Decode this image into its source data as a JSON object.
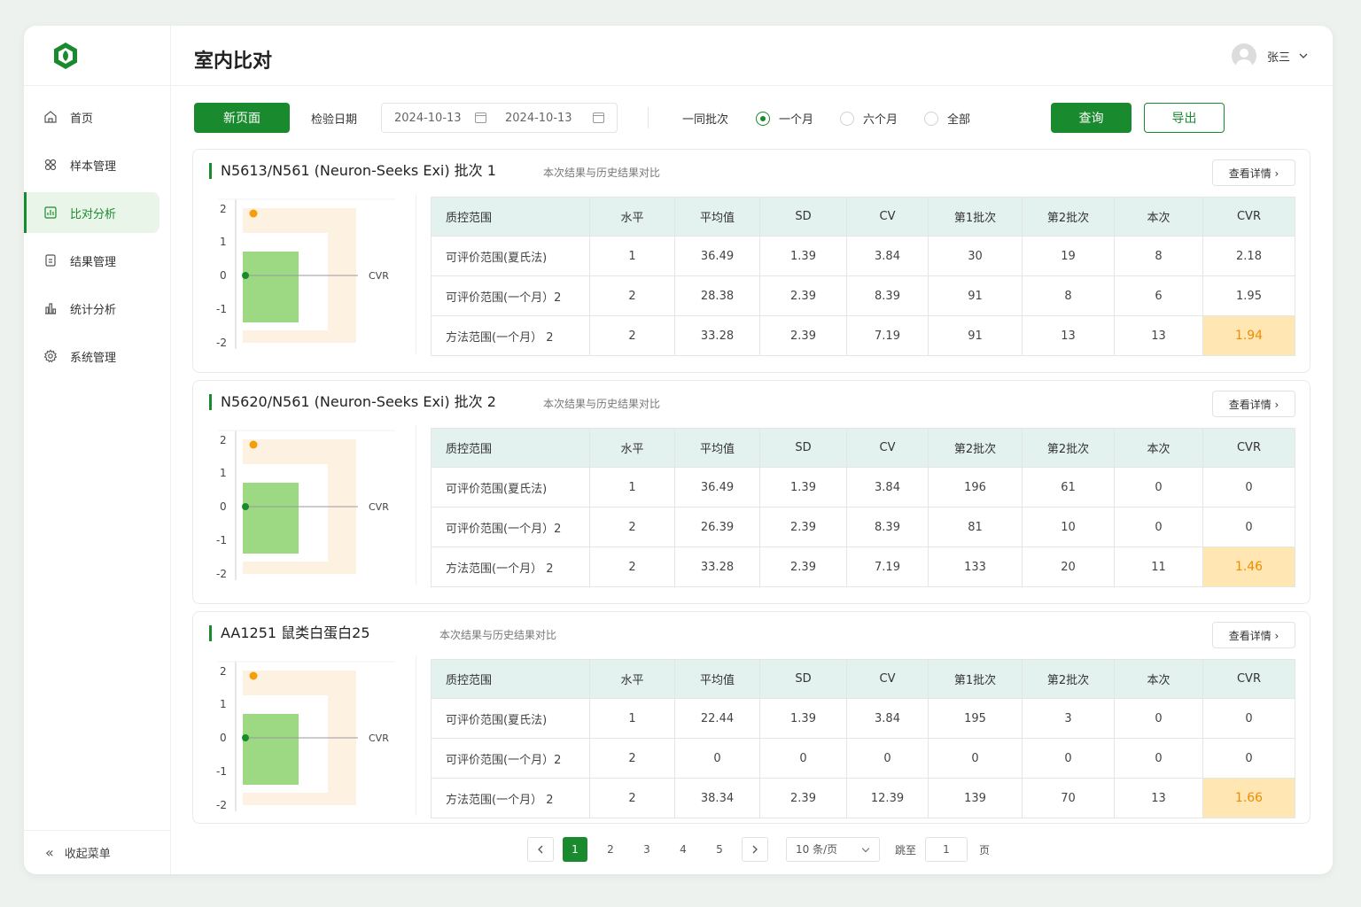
{
  "sidebar": {
    "items": [
      {
        "label": "首页",
        "icon": "home-icon"
      },
      {
        "label": "样本管理",
        "icon": "sample-icon"
      },
      {
        "label": "比对分析",
        "icon": "chart-icon",
        "active": true
      },
      {
        "label": "结果管理",
        "icon": "document-icon"
      },
      {
        "label": "统计分析",
        "icon": "bar-chart-icon"
      },
      {
        "label": "系统管理",
        "icon": "gear-icon"
      }
    ],
    "collapse_label": "收起菜单"
  },
  "header": {
    "title": "室内比对",
    "user_name": "张三"
  },
  "toolbar": {
    "new_page_label": "新页面",
    "date_label": "检验日期",
    "date_start": "2024-10-13",
    "date_end": "2024-10-13",
    "same_batch_label": "一同批次",
    "radios": [
      {
        "label": "一个月",
        "checked": true
      },
      {
        "label": "六个月",
        "checked": false
      },
      {
        "label": "全部",
        "checked": false
      }
    ],
    "query_label": "查询",
    "export_label": "导出"
  },
  "cards": [
    {
      "title": "N5613/N561 (Neuron-Seeks Exi)   批次 1",
      "subtitle": "本次结果与历史结果对比",
      "detail_label": "查看详情 ›",
      "chart_label": "CVR",
      "y_ticks": [
        "2",
        "1",
        "0",
        "-1",
        "-2"
      ],
      "headers": [
        "质控范围",
        "水平",
        "平均值",
        "SD",
        "CV",
        "第1批次",
        "第2批次",
        "本次",
        "CVR"
      ],
      "rows": [
        [
          "可评价范围(夏氏法)",
          "1",
          "36.49",
          "1.39",
          "3.84",
          "30",
          "19",
          "8",
          "2.18"
        ],
        [
          "可评价范围(一个月）2",
          "2",
          "28.38",
          "2.39",
          "8.39",
          "91",
          "8",
          "6",
          "1.95"
        ],
        [
          "方法范围(一个月） 2",
          "2",
          "33.28",
          "2.39",
          "7.19",
          "91",
          "13",
          "13",
          "1.94"
        ]
      ]
    },
    {
      "title": "N5620/N561 (Neuron-Seeks Exi)   批次 2",
      "subtitle": "本次结果与历史结果对比",
      "detail_label": "查看详情 ›",
      "chart_label": "CVR",
      "y_ticks": [
        "2",
        "1",
        "0",
        "-1",
        "-2"
      ],
      "headers": [
        "质控范围",
        "水平",
        "平均值",
        "SD",
        "CV",
        "第2批次",
        "第2批次",
        "本次",
        "CVR"
      ],
      "rows": [
        [
          "可评价范围(夏氏法)",
          "1",
          "36.49",
          "1.39",
          "3.84",
          "196",
          "61",
          "0",
          "0"
        ],
        [
          "可评价范围(一个月）2",
          "2",
          "26.39",
          "2.39",
          "8.39",
          "81",
          "10",
          "0",
          "0"
        ],
        [
          "方法范围(一个月） 2",
          "2",
          "33.28",
          "2.39",
          "7.19",
          "133",
          "20",
          "11",
          "1.46"
        ]
      ]
    },
    {
      "title": "AA1251  鼠类白蛋白25",
      "subtitle": "本次结果与历史结果对比",
      "detail_label": "查看详情 ›",
      "chart_label": "CVR",
      "y_ticks": [
        "2",
        "1",
        "0",
        "-1",
        "-2"
      ],
      "headers": [
        "质控范围",
        "水平",
        "平均值",
        "SD",
        "CV",
        "第1批次",
        "第2批次",
        "本次",
        "CVR"
      ],
      "rows": [
        [
          "可评价范围(夏氏法)",
          "1",
          "22.44",
          "1.39",
          "3.84",
          "195",
          "3",
          "0",
          "0"
        ],
        [
          "可评价范围(一个月）2",
          "2",
          "0",
          "0",
          "0",
          "0",
          "0",
          "0",
          "0"
        ],
        [
          "方法范围(一个月） 2",
          "2",
          "38.34",
          "2.39",
          "12.39",
          "139",
          "70",
          "13",
          "1.66"
        ]
      ]
    }
  ],
  "pagination": {
    "pages": [
      "1",
      "2",
      "3",
      "4",
      "5"
    ],
    "current": "1",
    "page_size": "10 条/页",
    "jump_label": "跳至",
    "jump_value": "1",
    "page_label": "页"
  },
  "colors": {
    "accent": "#1a8a2e",
    "highlight_bg": "#ffe6b3",
    "highlight_text": "#f08c00",
    "table_header": "#e3f2ee"
  }
}
